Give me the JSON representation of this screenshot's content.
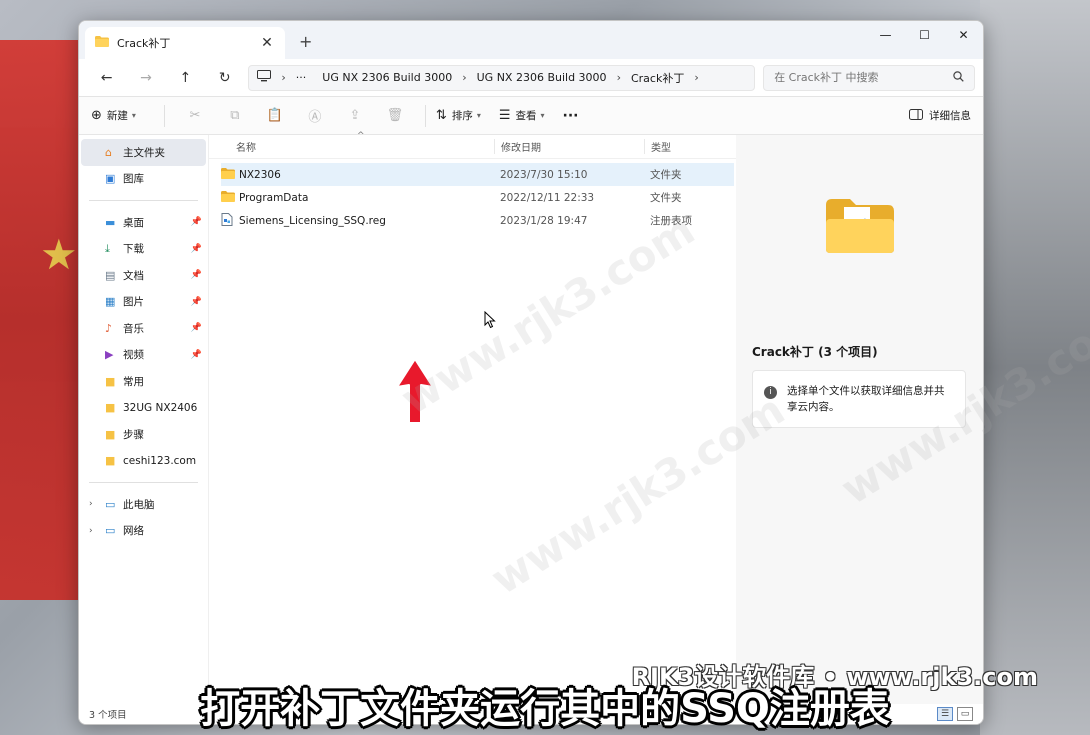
{
  "window": {
    "tab_title": "Crack补丁",
    "new_tab": "+",
    "controls": {
      "minimize": "—",
      "maximize": "☐",
      "close": "✕"
    }
  },
  "nav": {
    "back": "←",
    "forward": "→",
    "up": "↑",
    "refresh": "↻",
    "breadcrumb": [
      "UG NX 2306 Build 3000",
      "UG NX 2306 Build 3000",
      "Crack补丁"
    ],
    "ellipsis": "···",
    "search_placeholder": "在 Crack补丁 中搜索"
  },
  "toolbar": {
    "new_label": "新建",
    "sort_label": "排序",
    "view_label": "查看",
    "more": "···",
    "details_label": "详细信息"
  },
  "sidebar": {
    "top": [
      {
        "label": "主文件夹",
        "icon": "home-icon"
      },
      {
        "label": "图库",
        "icon": "gallery-icon"
      }
    ],
    "quick": [
      {
        "label": "桌面",
        "icon": "desktop-icon",
        "pinned": true
      },
      {
        "label": "下载",
        "icon": "download-icon",
        "pinned": true
      },
      {
        "label": "文档",
        "icon": "document-icon",
        "pinned": true
      },
      {
        "label": "图片",
        "icon": "pictures-icon",
        "pinned": true
      },
      {
        "label": "音乐",
        "icon": "music-icon",
        "pinned": true
      },
      {
        "label": "视频",
        "icon": "video-icon",
        "pinned": true
      },
      {
        "label": "常用",
        "icon": "folder-icon",
        "pinned": false
      },
      {
        "label": "32UG NX2406",
        "icon": "folder-icon",
        "pinned": false
      },
      {
        "label": "步骤",
        "icon": "folder-icon",
        "pinned": false
      },
      {
        "label": "ceshi123.com",
        "icon": "folder-icon",
        "pinned": false
      }
    ],
    "bottom": [
      {
        "label": "此电脑",
        "icon": "computer-icon"
      },
      {
        "label": "网络",
        "icon": "network-icon"
      }
    ]
  },
  "filelist": {
    "headers": {
      "name": "名称",
      "date": "修改日期",
      "type": "类型"
    },
    "rows": [
      {
        "name": "NX2306",
        "date": "2023/7/30 15:10",
        "type": "文件夹",
        "icon": "folder-icon"
      },
      {
        "name": "ProgramData",
        "date": "2022/12/11 22:33",
        "type": "文件夹",
        "icon": "folder-icon"
      },
      {
        "name": "Siemens_Licensing_SSQ.reg",
        "date": "2023/1/28 19:47",
        "type": "注册表项",
        "icon": "registry-icon"
      }
    ]
  },
  "details": {
    "title": "Crack补丁 (3 个项目)",
    "info": "选择单个文件以获取详细信息并共享云内容。"
  },
  "status": {
    "count": "3 个项目"
  },
  "overlay": {
    "caption": "打开补丁文件夹运行其中的SSQ注册表",
    "brand": "RJK3设计软件库 • www.rjk3.com",
    "watermark": "www.rjk3.com"
  },
  "colors": {
    "accent": "#0067c0",
    "folder": "#f6c244",
    "arrow": "#e8192c",
    "hover_row": "#e5f1fb"
  }
}
